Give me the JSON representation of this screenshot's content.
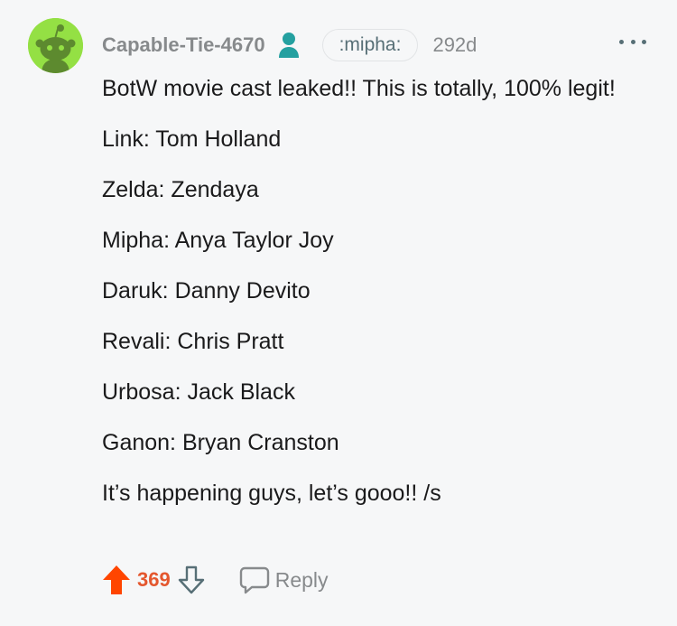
{
  "comment": {
    "username": "Capable-Tie-4670",
    "flair": ":mipha:",
    "timestamp": "292d",
    "avatar_icon": "snoo-avatar-icon",
    "op_icon": "user-icon",
    "paragraphs": [
      "BotW movie cast leaked!! This is totally, 100% legit!",
      "Link: Tom Holland",
      "Zelda: Zendaya",
      "Mipha: Anya Taylor Joy",
      "Daruk: Danny Devito",
      "Revali: Chris Pratt",
      "Urbosa: Jack Black",
      "Ganon: Bryan Cranston",
      "It’s happening guys, let’s gooo!! /s"
    ],
    "score": "369",
    "reply_label": "Reply"
  },
  "colors": {
    "upvote_active": "#ff4500",
    "score": "#e4572e",
    "muted": "#878a8c",
    "avatar_bg": "#94e044",
    "op_icon": "#24a0a0"
  }
}
